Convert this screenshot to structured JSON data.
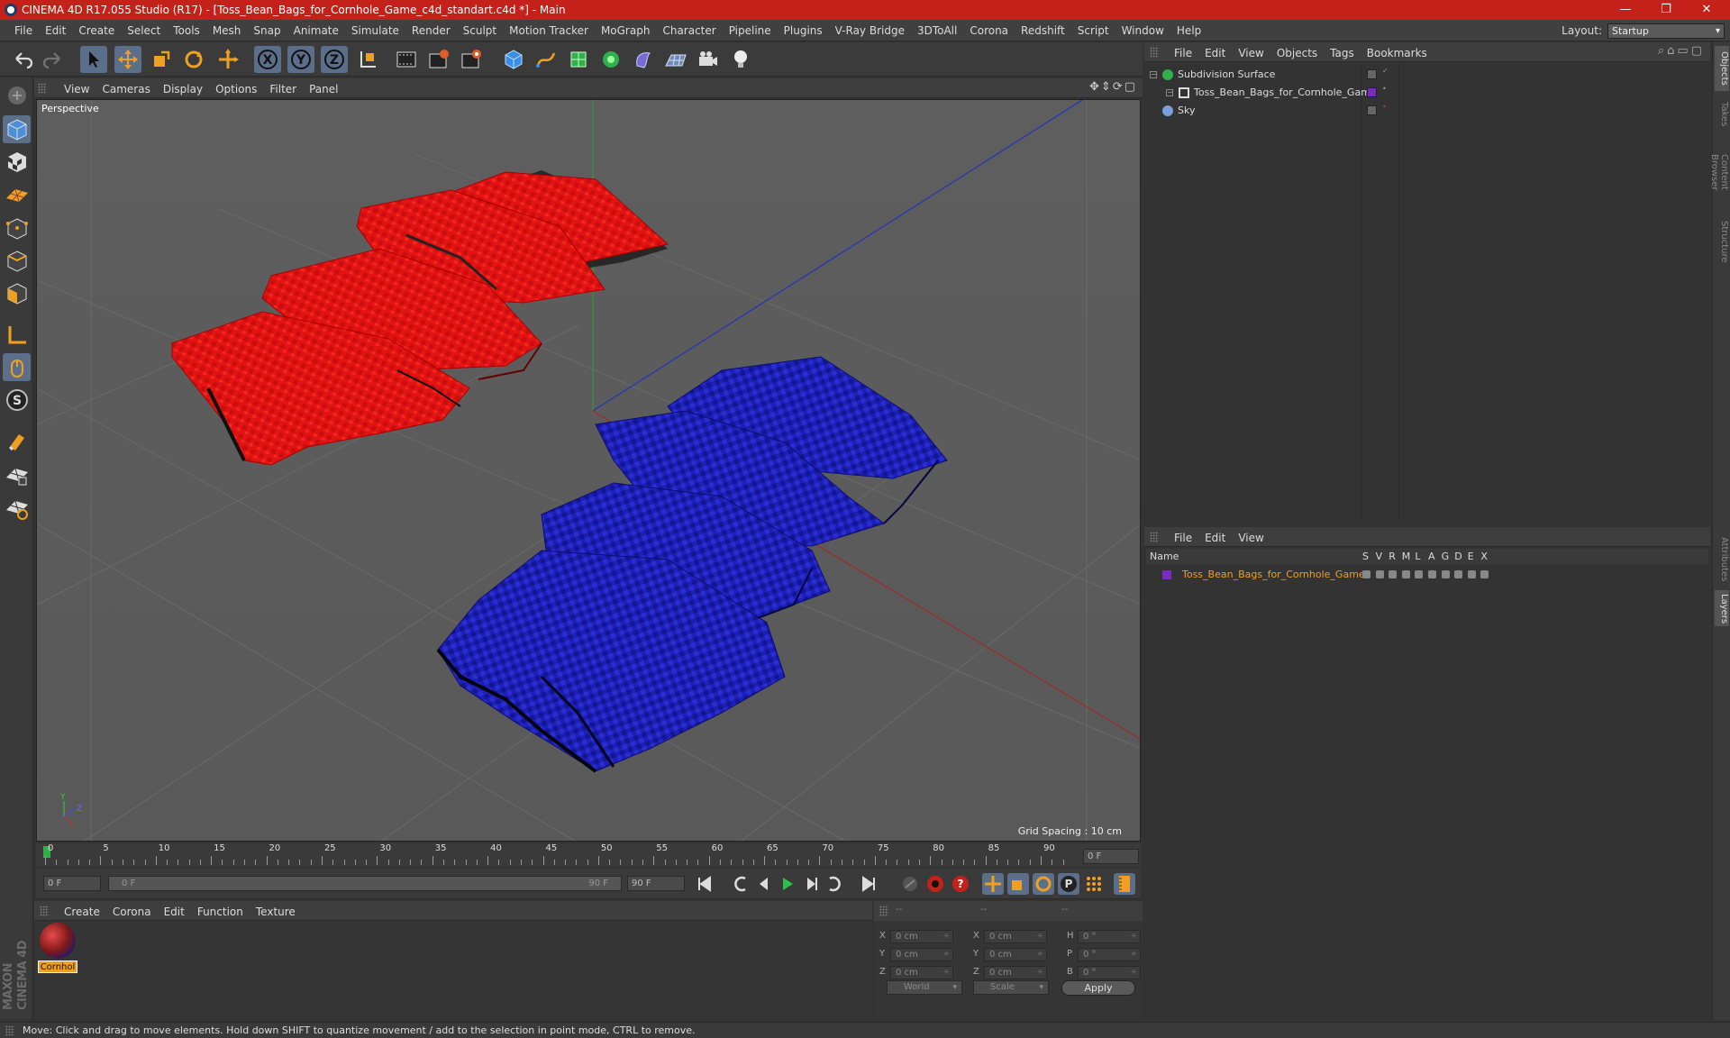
{
  "window": {
    "title": "CINEMA 4D R17.055 Studio (R17) - [Toss_Bean_Bags_for_Cornhole_Game_c4d_standart.c4d *] - Main",
    "minimize": "—",
    "maximize": "❐",
    "close": "✕"
  },
  "menubar": {
    "items": [
      "File",
      "Edit",
      "Create",
      "Select",
      "Tools",
      "Mesh",
      "Snap",
      "Animate",
      "Simulate",
      "Render",
      "Sculpt",
      "Motion Tracker",
      "MoGraph",
      "Character",
      "Pipeline",
      "Plugins",
      "V-Ray Bridge",
      "3DToAll",
      "Corona",
      "Redshift",
      "Script",
      "Window",
      "Help"
    ],
    "layout_label": "Layout:",
    "layout_value": "Startup"
  },
  "toolbar": {
    "icons": [
      "undo-icon",
      "redo-icon",
      "select-arrow-icon",
      "move-icon",
      "scale-icon",
      "rotate-icon",
      "move-all-icon",
      "x-axis-icon",
      "y-axis-icon",
      "z-axis-icon",
      "coordinate-system-icon",
      "render-view-icon",
      "render-picture-viewer-icon",
      "edit-render-settings-icon",
      "cube-icon",
      "pen-spline-icon",
      "subdivision-icon",
      "mograph-icon",
      "deformer-icon",
      "scene-floor-icon",
      "camera-icon",
      "light-icon"
    ],
    "axis_labels": [
      "X",
      "Y",
      "Z"
    ]
  },
  "viewport": {
    "menu": [
      "View",
      "Cameras",
      "Display",
      "Options",
      "Filter",
      "Panel"
    ],
    "label": "Perspective",
    "grid_spacing": "Grid Spacing : 10 cm",
    "bag_colors": {
      "red": "#e01010",
      "blue": "#1a1ab8"
    }
  },
  "timeline": {
    "ticks": [
      "0",
      "5",
      "10",
      "15",
      "20",
      "25",
      "30",
      "35",
      "40",
      "45",
      "50",
      "55",
      "60",
      "65",
      "70",
      "75",
      "80",
      "85",
      "90"
    ],
    "current_frame_field": "0 F",
    "start_field": "0 F",
    "range_start": "0 F",
    "range_end": "90 F",
    "end_field": "90 F"
  },
  "material_manager": {
    "menu": [
      "Create",
      "Corona",
      "Edit",
      "Function",
      "Texture"
    ],
    "materials": [
      {
        "name": "Cornhol"
      }
    ]
  },
  "coordinates": {
    "header": [
      "--",
      "--",
      "--"
    ],
    "rows": [
      {
        "a_label": "X",
        "a_val": "0 cm",
        "b_label": "X",
        "b_val": "0 cm",
        "c_label": "H",
        "c_val": "0 °"
      },
      {
        "a_label": "Y",
        "a_val": "0 cm",
        "b_label": "Y",
        "b_val": "0 cm",
        "c_label": "P",
        "c_val": "0 °"
      },
      {
        "a_label": "Z",
        "a_val": "0 cm",
        "b_label": "Z",
        "b_val": "0 cm",
        "c_label": "B",
        "c_val": "0 °"
      }
    ],
    "mode_select": "World",
    "type_select": "Scale",
    "apply": "Apply"
  },
  "object_manager": {
    "menu": [
      "File",
      "Edit",
      "View",
      "Objects",
      "Tags",
      "Bookmarks"
    ],
    "objects": [
      {
        "name": "Subdivision Surface"
      },
      {
        "name": "Toss_Bean_Bags_for_Cornhole_Game"
      },
      {
        "name": "Sky"
      }
    ]
  },
  "layer_manager": {
    "menu": [
      "File",
      "Edit",
      "View"
    ],
    "header_name": "Name",
    "columns": [
      "S",
      "V",
      "R",
      "M",
      "L",
      "A",
      "G",
      "D",
      "E",
      "X"
    ],
    "layers": [
      {
        "name": "Toss_Bean_Bags_for_Cornhole_Game",
        "color": "#7a2bc4"
      }
    ]
  },
  "right_tabs": [
    "Objects",
    "Takes",
    "Content Browser",
    "Structure",
    "Attributes",
    "Layers"
  ],
  "status": "Move: Click and drag to move elements. Hold down SHIFT to quantize movement / add to the selection in point mode, CTRL to remove.",
  "brand": "MAXON CINEMA 4D"
}
